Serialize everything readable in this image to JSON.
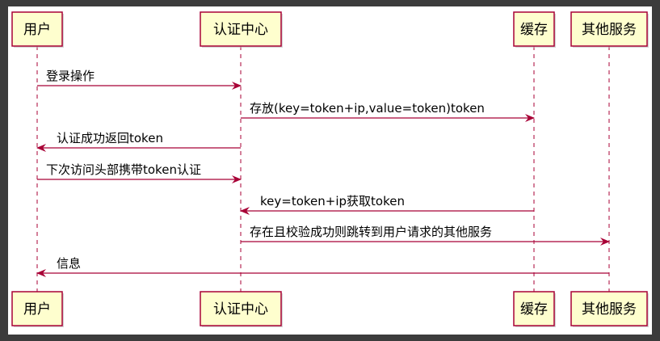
{
  "colors": {
    "participant_fill": "#fefece",
    "participant_border": "#a80036",
    "arrow": "#a80036",
    "lifeline": "#a80036",
    "text": "#000000",
    "frame_bg": "#3c3c3c",
    "canvas_bg": "#ffffff"
  },
  "participants": [
    {
      "id": "user",
      "label": "用户"
    },
    {
      "id": "auth",
      "label": "认证中心"
    },
    {
      "id": "cache",
      "label": "缓存"
    },
    {
      "id": "service",
      "label": "其他服务"
    }
  ],
  "messages": [
    {
      "from": "user",
      "to": "auth",
      "label": "登录操作"
    },
    {
      "from": "auth",
      "to": "cache",
      "label": "存放(key=token+ip,value=token)token"
    },
    {
      "from": "auth",
      "to": "user",
      "label": "认证成功返回token"
    },
    {
      "from": "user",
      "to": "auth",
      "label": "下次访问头部携带token认证"
    },
    {
      "from": "cache",
      "to": "auth",
      "label": "key=token+ip获取token"
    },
    {
      "from": "auth",
      "to": "service",
      "label": "存在且校验成功则跳转到用户请求的其他服务"
    },
    {
      "from": "service",
      "to": "user",
      "label": "信息"
    }
  ]
}
